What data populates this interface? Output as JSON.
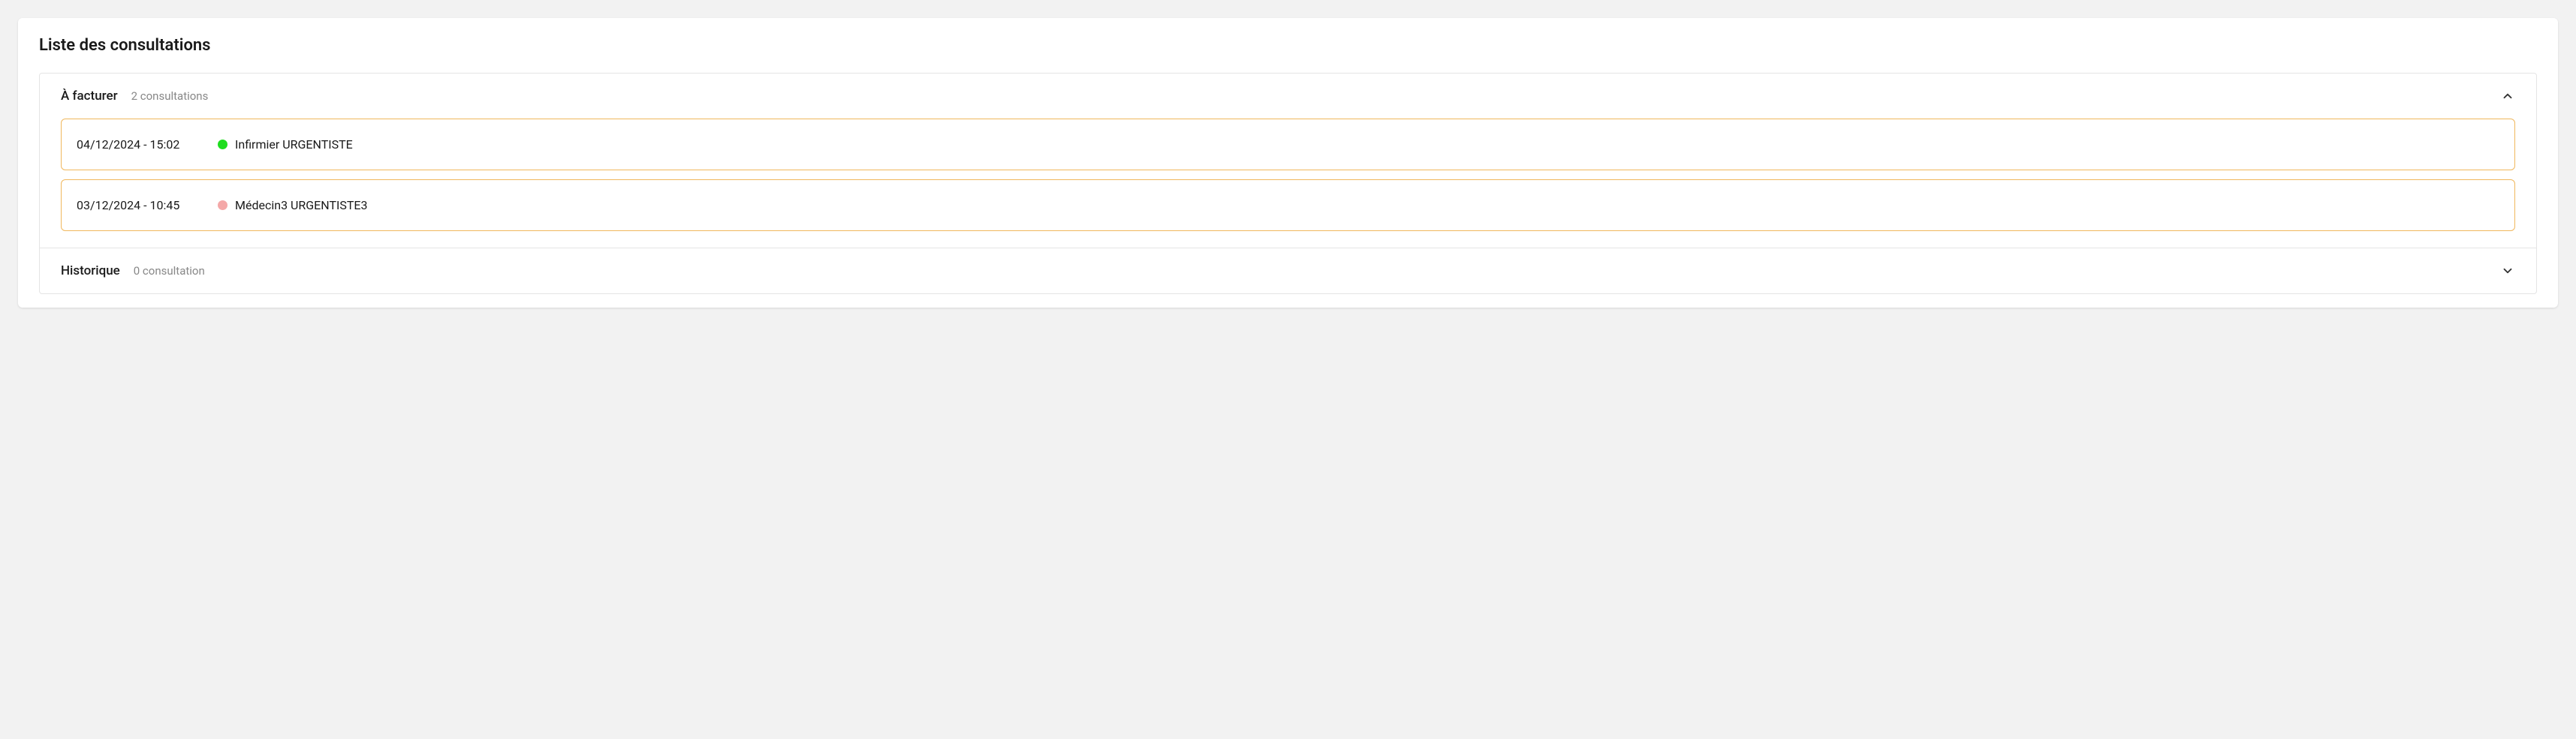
{
  "page": {
    "title": "Liste des consultations"
  },
  "sections": {
    "to_invoice": {
      "title": "À facturer",
      "count_label": "2 consultations",
      "expanded": true,
      "items": [
        {
          "datetime": "04/12/2024 - 15:02",
          "status_color": "#1fdd1f",
          "name": "Infirmier URGENTISTE"
        },
        {
          "datetime": "03/12/2024 - 10:45",
          "status_color": "#f4a8a8",
          "name": "Médecin3 URGENTISTE3"
        }
      ]
    },
    "history": {
      "title": "Historique",
      "count_label": "0 consultation",
      "expanded": false
    }
  }
}
